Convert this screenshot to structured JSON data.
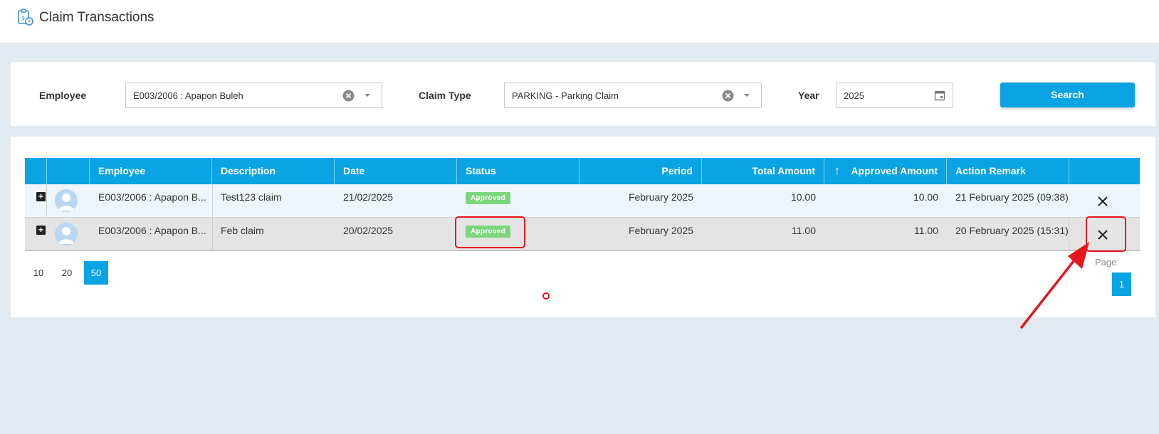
{
  "header": {
    "title": "Claim Transactions",
    "icon": "clipboard-clock-icon"
  },
  "filters": {
    "employee_label": "Employee",
    "employee_value": "E003/2006 : Apapon Buleh",
    "claim_type_label": "Claim Type",
    "claim_type_value": "PARKING - Parking Claim",
    "year_label": "Year",
    "year_value": "2025",
    "search_label": "Search"
  },
  "table": {
    "columns": [
      "Employee",
      "Description",
      "Date",
      "Status",
      "Period",
      "Total Amount",
      "Approved Amount",
      "Action Remark"
    ],
    "sort_icon": "↑",
    "rows": [
      {
        "employee": "E003/2006 : Apapon B...",
        "description": "Test123 claim",
        "date": "21/02/2025",
        "status": "Approved",
        "period": "February 2025",
        "total": "10.00",
        "approved": "10.00",
        "remark": "21 February 2025 (09:38) T"
      },
      {
        "employee": "E003/2006 : Apapon B...",
        "description": "Feb claim",
        "date": "20/02/2025",
        "status": "Approved",
        "period": "February 2025",
        "total": "11.00",
        "approved": "11.00",
        "remark": "20 February 2025 (15:31) T"
      }
    ]
  },
  "pager": {
    "sizes": [
      "10",
      "20",
      "50"
    ],
    "active_size": "50",
    "page_label": "Page:",
    "current_page": "1"
  },
  "colors": {
    "accent": "#0aa3e3",
    "badge": "#7cd67c",
    "annotation": "#e8141c"
  }
}
